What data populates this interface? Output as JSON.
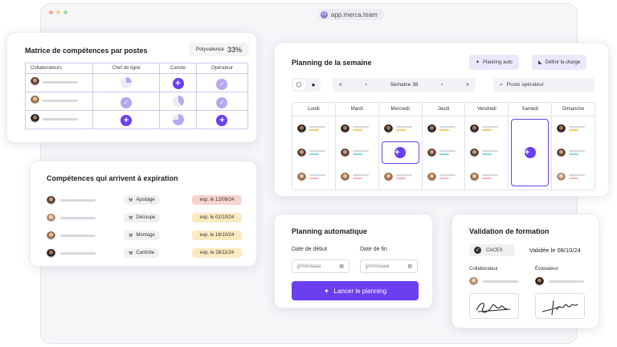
{
  "browser": {
    "url": "app.merca.team",
    "dot_colors": [
      "#f2a7a0",
      "#f6d38b",
      "#9fd8a8"
    ]
  },
  "matrix": {
    "title": "Matrice de compétences par postes",
    "polyvalence_label": "Polyvalence",
    "polyvalence_value": "33%",
    "columns": [
      "Collaborateurs",
      "Chef de ligne",
      "Cariste",
      "Opérateur"
    ],
    "rows": [
      {
        "avatar": "avatar-1",
        "cells": [
          "quarter",
          "plus",
          "check"
        ]
      },
      {
        "avatar": "avatar-2",
        "cells": [
          "check",
          "quarter-alt",
          "check"
        ]
      },
      {
        "avatar": "avatar-3",
        "cells": [
          "plus",
          "three-quarter",
          "plus"
        ]
      }
    ]
  },
  "expiring": {
    "title": "Compétences qui arrivent à expiration",
    "items": [
      {
        "skill": "Ajustage",
        "date": "exp. le 12/09/24",
        "color": "#f8d3d0"
      },
      {
        "skill": "Découpe",
        "date": "exp. le 02/10/24",
        "color": "#fbeac0"
      },
      {
        "skill": "Montage",
        "date": "exp. le 16/10/24",
        "color": "#fbeac0"
      },
      {
        "skill": "Contrôle",
        "date": "exp. le 28/11/24",
        "color": "#fbeac0"
      }
    ]
  },
  "planning": {
    "title": "Planning de la semaine",
    "auto_button": "Planning auto",
    "load_button": "Définir la charge",
    "week": "Semaine 38",
    "search_placeholder": "Poste opérateur",
    "days": [
      "Lundi",
      "Mardi",
      "Mercredi",
      "Jeudi",
      "Vendredi",
      "Samedi",
      "Dimanche"
    ]
  },
  "auto": {
    "title": "Planning automatique",
    "start_label": "Date de début",
    "end_label": "Date de fin",
    "start_placeholder": "jj/mm/aaaa",
    "end_placeholder": "jj/mm/aaaa",
    "launch": "Lancer le planning"
  },
  "validation": {
    "title": "Validation de formation",
    "badge": "CACES",
    "date": "Validée le 08/10/24",
    "collaborator_label": "Collaborateur",
    "evaluator_label": "Évaluateur"
  },
  "colors": {
    "accent": "#6b3ff0",
    "accent_light": "#b8a6ee",
    "border": "#cfc8ee"
  }
}
